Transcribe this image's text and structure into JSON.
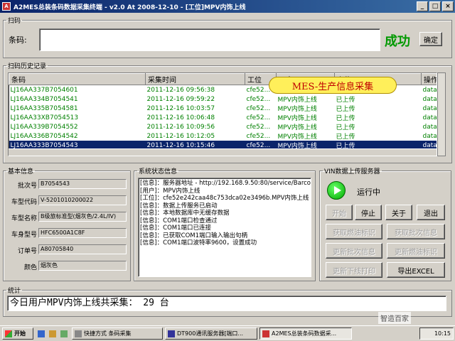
{
  "window": {
    "title": "A2MES总装条码数据采集终端 - v2.0 At 2008-12-10 - [工位]MPV内饰上线",
    "min": "_",
    "max": "□",
    "close": "×"
  },
  "scan": {
    "group": "扫码",
    "label": "条码:",
    "value": "",
    "status": "成功",
    "confirm": "确定",
    "status_color": "#009900"
  },
  "history": {
    "group": "扫码历史记录",
    "headers": [
      "条码",
      "采集时间",
      "工位",
      "用户",
      "上传",
      "操作"
    ],
    "rows": [
      [
        "LJ16AA337B7054601",
        "2011-12-16 09:56:38",
        "cfe52...",
        "MPV内饰上线",
        "已上传",
        "data..."
      ],
      [
        "LJ16AA334B7054541",
        "2011-12-16 09:59:22",
        "cfe52...",
        "MPV内饰上线",
        "已上传",
        "data..."
      ],
      [
        "LJ16AA335B7054581",
        "2011-12-16 10:03:57",
        "cfe52...",
        "MPV内饰上线",
        "已上传",
        "data..."
      ],
      [
        "LJ16AA33XB7054513",
        "2011-12-16 10:06:48",
        "cfe52...",
        "MPV内饰上线",
        "已上传",
        "data..."
      ],
      [
        "LJ16AA339B7054552",
        "2011-12-16 10:09:56",
        "cfe52...",
        "MPV内饰上线",
        "已上传",
        "data..."
      ],
      [
        "LJ16AA336B7054542",
        "2011-12-16 10:12:05",
        "cfe52...",
        "MPV内饰上线",
        "已上传",
        "data..."
      ],
      [
        "LJ16AA333B7054543",
        "2011-12-16 10:15:46",
        "cfe52...",
        "MPV内饰上线",
        "已上传",
        "data..."
      ]
    ],
    "overlay": "MES-生产信息采集"
  },
  "basic": {
    "group": "基本信息",
    "fields": [
      {
        "label": "批次号",
        "value": "B7054543"
      },
      {
        "label": "车型代码",
        "value": "V-5201010200022"
      },
      {
        "label": "车型名称",
        "value": "B级旅标准型(烟灰色/2.4L/IV)"
      },
      {
        "label": "车身型号",
        "value": "HFC6500A1C8F"
      },
      {
        "label": "订单号",
        "value": "A80705840"
      },
      {
        "label": "颜色",
        "value": "烟灰色"
      }
    ]
  },
  "sysstatus": {
    "group": "系统状态信息",
    "lines": [
      "[信息]：服务器地址 - http://192.168.9.50:80/service/Barcode",
      "[用户]：MPV内饰上线",
      "[工位]：cfe52e242caa48c753dca02e3496b.MPV内饰上线",
      "[信息]：数据上传服务已启动",
      "[信息]：本地数据库中无缓存数据",
      "[信息]：COM1端口检查通过",
      "[信息]：COM1端口已连接",
      "[信息]：已获取COM1端口输入输出句柄",
      "[信息]：COM1端口波特率9600，设置成功"
    ]
  },
  "vin": {
    "group": "VIN数据上传服务器",
    "state": "运行中",
    "buttons": {
      "start": "开始",
      "stop": "停止",
      "about": "关于",
      "exit": "退出",
      "get_fuel": "获取燃油标识",
      "get_batch": "获取批次信息",
      "upd_batch": "更新批次信息",
      "upd_fuel": "更新燃油标识",
      "upd_offline": "更新下线打印",
      "export": "导出EXCEL"
    }
  },
  "stats": {
    "group": "统计",
    "text": "今日用户MPV内饰上线共采集： 29 台"
  },
  "taskbar": {
    "start": "开始",
    "items": [
      "快捷方式 条码采集",
      "DT900通讯服务器[端口...",
      "A2MES总装条码数据采..."
    ],
    "clock": "10:15",
    "watermark": "智造百家"
  }
}
